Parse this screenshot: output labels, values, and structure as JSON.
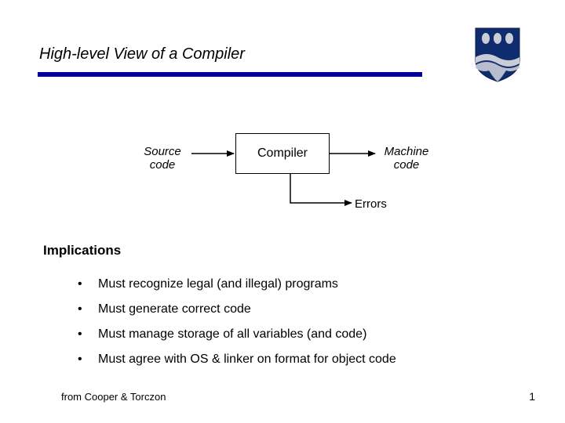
{
  "title": "High-level View of a Compiler",
  "diagram": {
    "source_line1": "Source",
    "source_line2": "code",
    "compiler_label": "Compiler",
    "machine_line1": "Machine",
    "machine_line2": "code",
    "errors_label": "Errors"
  },
  "section_heading": "Implications",
  "bullets": [
    "Must recognize legal (and illegal) programs",
    "Must generate correct code",
    "Must manage storage of all variables (and code)",
    "Must agree with OS & linker on format for object code"
  ],
  "footer": {
    "left": "from Cooper & Torczon",
    "page_number": "1"
  },
  "colors": {
    "accent": "#000099",
    "shield_blue": "#0F2C6E",
    "shield_silver": "#C9CDD6"
  }
}
